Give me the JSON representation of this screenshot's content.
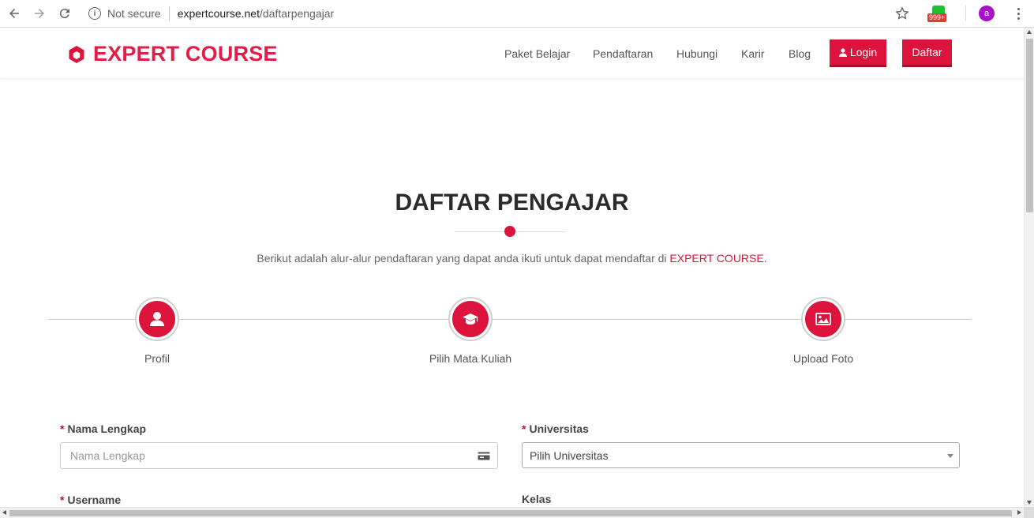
{
  "browser": {
    "security_label": "Not secure",
    "url_host": "expertcourse.net",
    "url_path": "/daftarpengajar",
    "extension_badge": "999+",
    "profile_initial": "a"
  },
  "header": {
    "logo_text": "EXPERT COURSE",
    "nav": [
      "Paket Belajar",
      "Pendaftaran",
      "Hubungi",
      "Karir",
      "Blog"
    ],
    "login_label": "Login",
    "register_label": "Daftar"
  },
  "main": {
    "title": "DAFTAR PENGAJAR",
    "subtitle_prefix": "Berikut adalah alur-alur pendaftaran yang dapat anda ikuti untuk dapat mendaftar di ",
    "subtitle_brand": "EXPERT COURSE",
    "subtitle_suffix": ".",
    "steps": [
      {
        "label": "Profil",
        "icon": "user-icon"
      },
      {
        "label": "Pilih Mata Kuliah",
        "icon": "graduation-cap-icon"
      },
      {
        "label": "Upload Foto",
        "icon": "image-icon"
      }
    ]
  },
  "form": {
    "full_name": {
      "label": "Nama Lengkap",
      "required_mark": "*",
      "placeholder": "Nama Lengkap"
    },
    "university": {
      "label": "Universitas",
      "required_mark": "*",
      "selected": "Pilih Universitas"
    },
    "username": {
      "label": "Username",
      "required_mark": "*"
    },
    "class": {
      "label": "Kelas"
    }
  },
  "colors": {
    "brand": "#dc143c",
    "brand_dark": "#a30f2d"
  }
}
